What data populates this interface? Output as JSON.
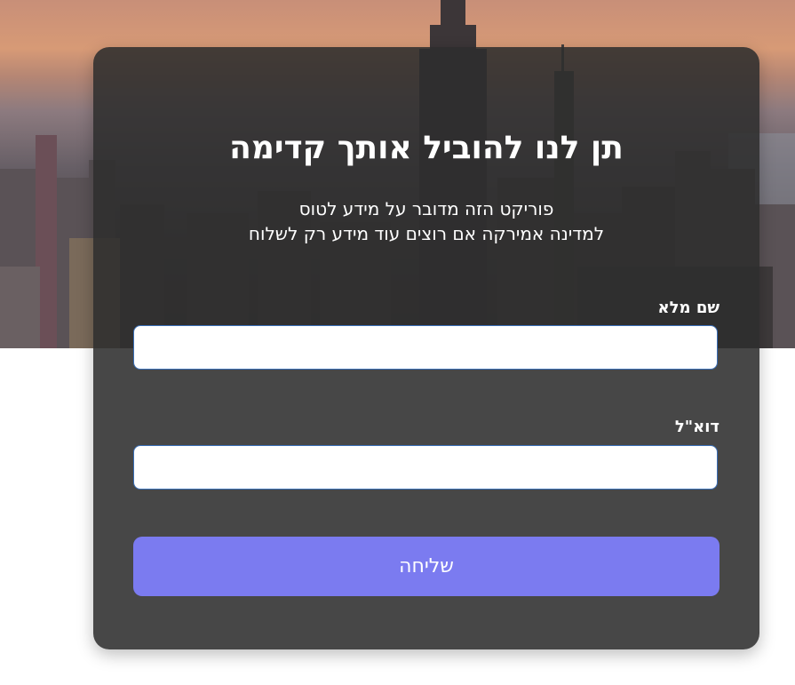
{
  "form": {
    "title": "תן לנו להוביל אותך קדימה",
    "subtitle_line1": "פוריקט הזה מדובר על מידע לטוס",
    "subtitle_line2": "למדינה אמירקה אם רוצים עוד מידע רק לשלוח",
    "full_name_label": "שם מלא",
    "full_name_value": "",
    "email_label": "דוא\"ל",
    "email_value": "",
    "submit_label": "שליחה"
  },
  "colors": {
    "card_background": "#2e2e2e",
    "button": "#7b7bf0",
    "input_border": "#3a6fb8"
  }
}
